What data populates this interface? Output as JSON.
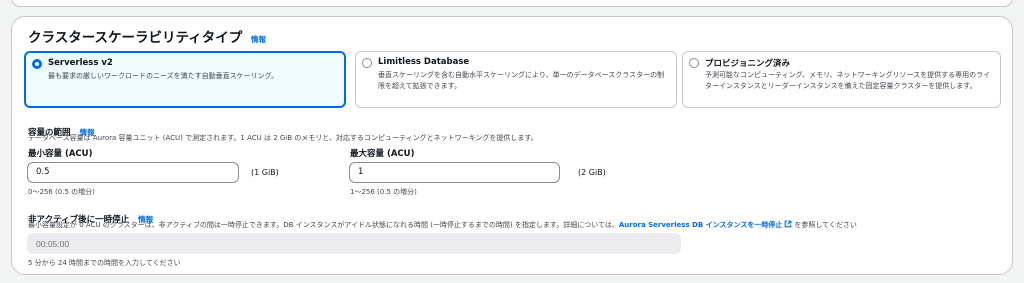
{
  "section": {
    "title": "クラスタースケーラビリティタイプ",
    "info_link": "情報"
  },
  "scalability_options": [
    {
      "title": "Serverless v2",
      "description": "最も要求の厳しいワークロードのニーズを満たす自動垂直スケーリング。",
      "selected": true
    },
    {
      "title": "Limitless Database",
      "description": "垂直スケーリングを含む自動水平スケーリングにより、単一のデータベースクラスターの制限を超えて拡張できます。",
      "selected": false
    },
    {
      "title": "プロビジョニング済み",
      "description": "予測可能なコンピューティング、メモリ、ネットワーキングリソースを提供する専用のライターインスタンスとリーダーインスタンスを備えた固定容量クラスターを提供します。",
      "selected": false
    }
  ],
  "capacity": {
    "label": "容量の範囲",
    "info_link": "情報",
    "description": "データベース容量は Aurora 容量ユニット (ACU) で測定されます。1 ACU は 2 GiB のメモリと、対応するコンピューティングとネットワーキングを提供します。",
    "min": {
      "label": "最小容量 (ACU)",
      "value": "0.5",
      "unit": "(1 GiB)",
      "hint": "0〜256 (0.5 の増分)"
    },
    "max": {
      "label": "最大容量 (ACU)",
      "value": "1",
      "unit": "(2 GiB)",
      "hint": "1〜256 (0.5 の増分)"
    }
  },
  "pause": {
    "label": "非アクティブ後に一時停止",
    "info_link": "情報",
    "description_before": "最小容量設定が 0 ACU のクラスターは、非アクティブの間は一時停止できます。DB インスタンスがアイドル状態になれる時間 (一時停止するまでの時間) を指定します。詳細については、",
    "link_text": "Aurora Serverless DB インスタンスを一時停止",
    "description_after": "を参照してください",
    "placeholder": "00:05:00",
    "hint": "5 分から 24 時間までの時間を入力してください"
  },
  "colors": {
    "accent": "#006ce0",
    "selected_bg": "#f0fbff",
    "border": "#c6c6cd"
  }
}
